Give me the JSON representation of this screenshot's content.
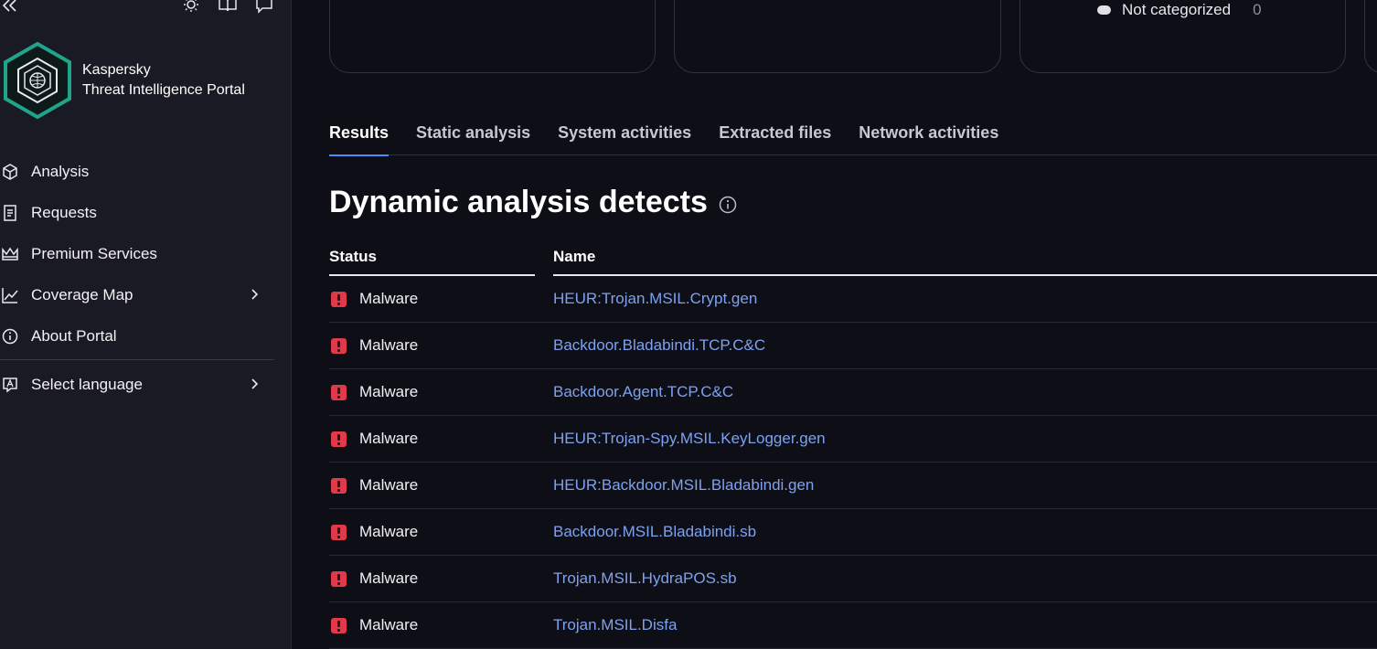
{
  "sidebar": {
    "brand_line1": "Kaspersky",
    "brand_line2": "Threat Intelligence Portal",
    "nav": [
      {
        "label": "Analysis",
        "icon": "cube-icon"
      },
      {
        "label": "Requests",
        "icon": "document-icon"
      },
      {
        "label": "Premium Services",
        "icon": "crown-icon"
      },
      {
        "label": "Coverage Map",
        "icon": "chart-line-icon",
        "has_submenu": true
      },
      {
        "label": "About Portal",
        "icon": "info-icon"
      }
    ],
    "language": {
      "label": "Select language",
      "icon": "language-icon"
    }
  },
  "cards": {
    "legend_label": "Not categorized",
    "legend_count": "0"
  },
  "tabs": [
    {
      "label": "Results",
      "active": true
    },
    {
      "label": "Static analysis"
    },
    {
      "label": "System activities"
    },
    {
      "label": "Extracted files"
    },
    {
      "label": "Network activities"
    }
  ],
  "heading": "Dynamic analysis detects",
  "table": {
    "columns": {
      "status": "Status",
      "name": "Name"
    },
    "rows": [
      {
        "status": "Malware",
        "name": "HEUR:Trojan.MSIL.Crypt.gen"
      },
      {
        "status": "Malware",
        "name": "Backdoor.Bladabindi.TCP.C&C"
      },
      {
        "status": "Malware",
        "name": "Backdoor.Agent.TCP.C&C"
      },
      {
        "status": "Malware",
        "name": "HEUR:Trojan-Spy.MSIL.KeyLogger.gen"
      },
      {
        "status": "Malware",
        "name": "HEUR:Backdoor.MSIL.Bladabindi.gen"
      },
      {
        "status": "Malware",
        "name": "Backdoor.MSIL.Bladabindi.sb"
      },
      {
        "status": "Malware",
        "name": "Trojan.MSIL.HydraPOS.sb"
      },
      {
        "status": "Malware",
        "name": "Trojan.MSIL.Disfa"
      }
    ]
  },
  "colors": {
    "accent": "#4d8cf5",
    "link": "#7da2f0",
    "malware": "#e0394a",
    "logo": "#1fa58a"
  }
}
